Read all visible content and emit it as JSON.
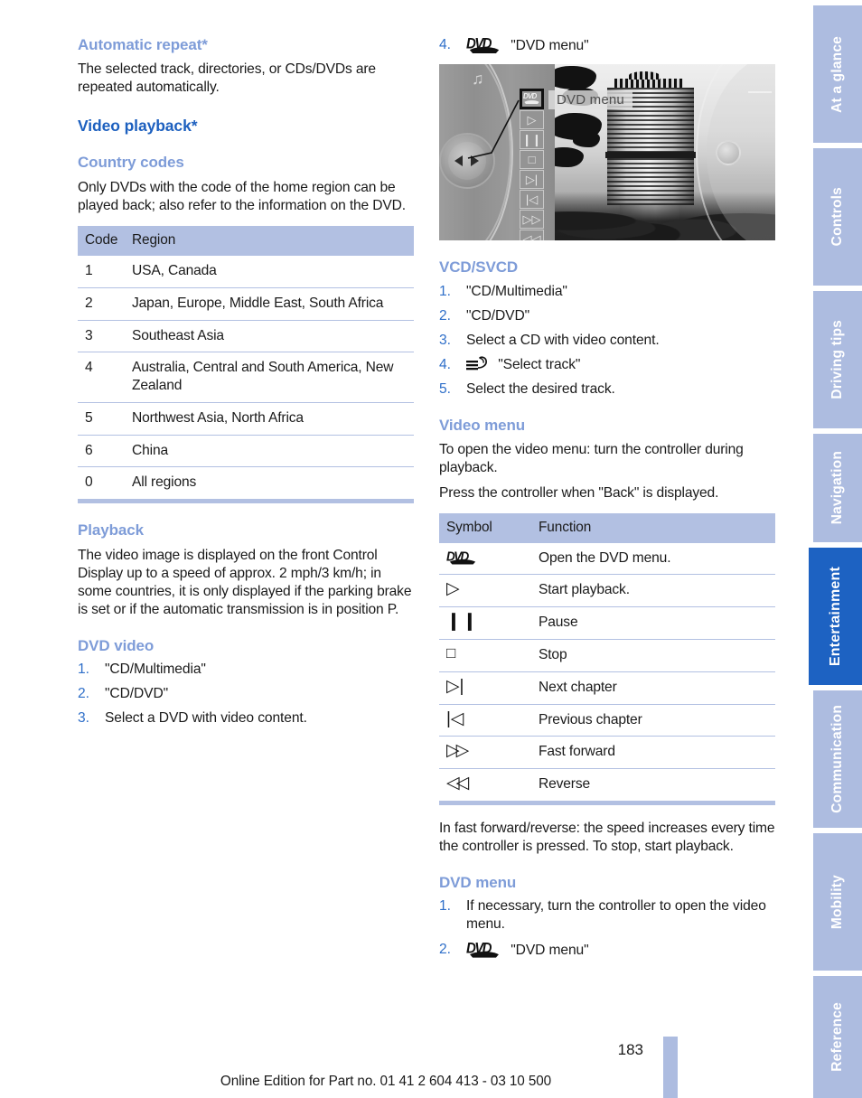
{
  "document": {
    "page_number": "183",
    "footer": "Online Edition for Part no. 01 41 2 604 413 - 03 10 500"
  },
  "sidebar": {
    "tabs": [
      {
        "label": "At a glance",
        "active": false
      },
      {
        "label": "Controls",
        "active": false
      },
      {
        "label": "Driving tips",
        "active": false
      },
      {
        "label": "Navigation",
        "active": false
      },
      {
        "label": "Entertainment",
        "active": true
      },
      {
        "label": "Communication",
        "active": false
      },
      {
        "label": "Mobility",
        "active": false
      },
      {
        "label": "Reference",
        "active": false
      }
    ],
    "active_color": "#1d62c2",
    "inactive_color": "#adbce0"
  },
  "left_column": {
    "automatic_repeat": {
      "heading": "Automatic repeat*",
      "body": "The selected track, directories, or CDs/DVDs are repeated automatically."
    },
    "video_playback": {
      "heading": "Video playback*"
    },
    "country_codes": {
      "heading": "Country codes",
      "body": "Only DVDs with the code of the home region can be played back; also refer to the information on the DVD.",
      "table": {
        "headers": [
          "Code",
          "Region"
        ],
        "rows": [
          [
            "1",
            "USA, Canada"
          ],
          [
            "2",
            "Japan, Europe, Middle East, South Africa"
          ],
          [
            "3",
            "Southeast Asia"
          ],
          [
            "4",
            "Australia, Central and South America, New Zealand"
          ],
          [
            "5",
            "Northwest Asia, North Africa"
          ],
          [
            "6",
            "China"
          ],
          [
            "0",
            "All regions"
          ]
        ]
      }
    },
    "playback": {
      "heading": "Playback",
      "body": "The video image is displayed on the front Control Display up to a speed of approx. 2 mph/3 km/h; in some countries, it is only displayed if the parking brake is set or if the automatic transmission is in position P."
    },
    "dvd_video": {
      "heading": "DVD video",
      "steps": [
        {
          "num": "1.",
          "text": "\"CD/Multimedia\""
        },
        {
          "num": "2.",
          "text": "\"CD/DVD\""
        },
        {
          "num": "3.",
          "text": "Select a DVD with video content."
        }
      ]
    }
  },
  "right_column": {
    "step4": {
      "num": "4.",
      "icon": "dvd-logo-icon",
      "text": "\"DVD menu\""
    },
    "figure": {
      "name": "idrive-control-display-screenshot",
      "tooltip": "DVD menu",
      "buttons": [
        "dvd-menu-button",
        "play-button",
        "pause-button",
        "stop-button",
        "next-chapter-button",
        "previous-chapter-button",
        "fast-forward-button",
        "reverse-button"
      ],
      "active_button": "dvd-menu-button",
      "glyphs": [
        "",
        "▷",
        "❙❙",
        "□",
        "▷|",
        "|◁",
        "▷▷",
        "◁◁"
      ]
    },
    "vcd_svcd": {
      "heading": "VCD/SVCD",
      "steps": [
        {
          "num": "1.",
          "text": "\"CD/Multimedia\"",
          "icon": null
        },
        {
          "num": "2.",
          "text": "\"CD/DVD\"",
          "icon": null
        },
        {
          "num": "3.",
          "text": "Select a CD with video content.",
          "icon": null
        },
        {
          "num": "4.",
          "text": "\"Select track\"",
          "icon": "select-track-icon"
        },
        {
          "num": "5.",
          "text": "Select the desired track.",
          "icon": null
        }
      ]
    },
    "video_menu": {
      "heading": "Video menu",
      "body1": "To open the video menu: turn the controller during playback.",
      "body2": "Press the controller when \"Back\" is displayed.",
      "table": {
        "headers": [
          "Symbol",
          "Function"
        ],
        "rows": [
          {
            "symbol": "dvd-logo-icon",
            "glyph": "",
            "function": "Open the DVD menu."
          },
          {
            "symbol": "play-icon",
            "glyph": "▷",
            "function": "Start playback."
          },
          {
            "symbol": "pause-icon",
            "glyph": "❙❙",
            "function": "Pause"
          },
          {
            "symbol": "stop-icon",
            "glyph": "□",
            "function": "Stop"
          },
          {
            "symbol": "next-chapter-icon",
            "glyph": "▷|",
            "function": "Next chapter"
          },
          {
            "symbol": "previous-chapter-icon",
            "glyph": "|◁",
            "function": "Previous chapter"
          },
          {
            "symbol": "fast-forward-icon",
            "glyph": "▷▷",
            "function": "Fast forward"
          },
          {
            "symbol": "reverse-icon",
            "glyph": "◁◁",
            "function": "Reverse"
          }
        ]
      },
      "note": "In fast forward/reverse: the speed increases every time the controller is pressed. To stop, start playback."
    },
    "dvd_menu": {
      "heading": "DVD menu",
      "steps": [
        {
          "num": "1.",
          "text": "If necessary, turn the controller to open the video menu.",
          "icon": null
        },
        {
          "num": "2.",
          "text": "\"DVD menu\"",
          "icon": "dvd-logo-icon"
        }
      ]
    }
  },
  "colors": {
    "heading_major": "#1d60bf",
    "heading_minor": "#7e9cd8",
    "table_header_bg": "#b2c0e2",
    "step_number": "#2f6fc9",
    "body_text": "#1a1a1a"
  }
}
